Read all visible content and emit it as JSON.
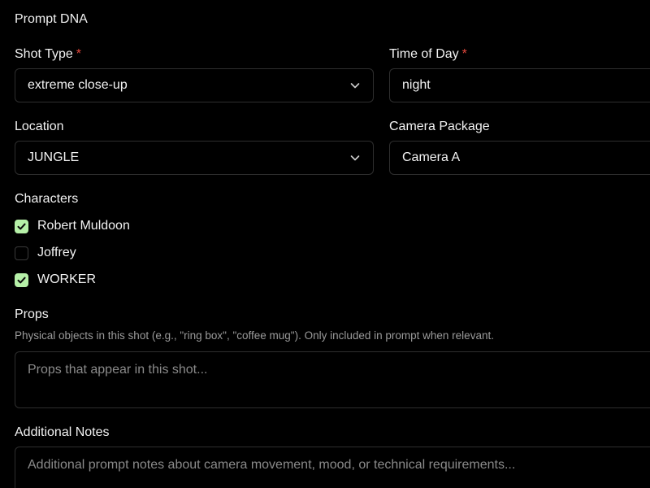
{
  "section": {
    "title": "Prompt DNA"
  },
  "shot_type": {
    "label": "Shot Type",
    "required_mark": "*",
    "value": "extreme close-up",
    "chevron_icon": "chevron-down-icon"
  },
  "time_of_day": {
    "label": "Time of Day",
    "required_mark": "*",
    "value": "night"
  },
  "location": {
    "label": "Location",
    "value": "JUNGLE",
    "chevron_icon": "chevron-down-icon"
  },
  "camera_package": {
    "label": "Camera Package",
    "value": "Camera A"
  },
  "characters": {
    "label": "Characters",
    "items": [
      {
        "label": "Robert Muldoon",
        "checked": true
      },
      {
        "label": "Joffrey",
        "checked": false
      },
      {
        "label": "WORKER",
        "checked": true
      }
    ]
  },
  "props": {
    "label": "Props",
    "help": "Physical objects in this shot (e.g., \"ring box\", \"coffee mug\"). Only included in prompt when relevant.",
    "placeholder": "Props that appear in this shot..."
  },
  "additional_notes": {
    "label": "Additional Notes",
    "placeholder": "Additional prompt notes about camera movement, mood, or technical requirements..."
  },
  "colors": {
    "background": "#000000",
    "required": "#e5483d",
    "checkbox_checked": "#b6f0a8",
    "border": "#2e2e2e"
  }
}
